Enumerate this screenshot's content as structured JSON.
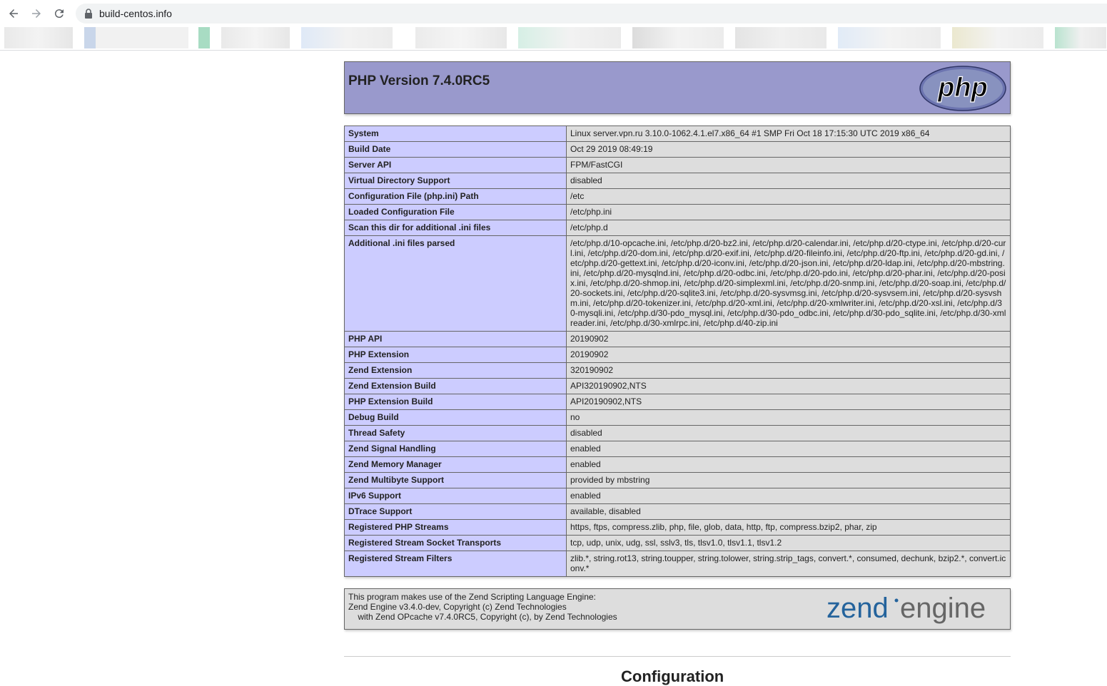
{
  "browser": {
    "url": "build-centos.info"
  },
  "header": {
    "title": "PHP Version 7.4.0RC5",
    "logo_text": "php"
  },
  "info_rows": [
    {
      "key": "System",
      "value": "Linux server.vpn.ru 3.10.0-1062.4.1.el7.x86_64 #1 SMP Fri Oct 18 17:15:30 UTC 2019 x86_64"
    },
    {
      "key": "Build Date",
      "value": "Oct 29 2019 08:49:19"
    },
    {
      "key": "Server API",
      "value": "FPM/FastCGI"
    },
    {
      "key": "Virtual Directory Support",
      "value": "disabled"
    },
    {
      "key": "Configuration File (php.ini) Path",
      "value": "/etc"
    },
    {
      "key": "Loaded Configuration File",
      "value": "/etc/php.ini"
    },
    {
      "key": "Scan this dir for additional .ini files",
      "value": "/etc/php.d"
    },
    {
      "key": "Additional .ini files parsed",
      "value": "/etc/php.d/10-opcache.ini, /etc/php.d/20-bz2.ini, /etc/php.d/20-calendar.ini, /etc/php.d/20-ctype.ini, /etc/php.d/20-curl.ini, /etc/php.d/20-dom.ini, /etc/php.d/20-exif.ini, /etc/php.d/20-fileinfo.ini, /etc/php.d/20-ftp.ini, /etc/php.d/20-gd.ini, /etc/php.d/20-gettext.ini, /etc/php.d/20-iconv.ini, /etc/php.d/20-json.ini, /etc/php.d/20-ldap.ini, /etc/php.d/20-mbstring.ini, /etc/php.d/20-mysqlnd.ini, /etc/php.d/20-odbc.ini, /etc/php.d/20-pdo.ini, /etc/php.d/20-phar.ini, /etc/php.d/20-posix.ini, /etc/php.d/20-shmop.ini, /etc/php.d/20-simplexml.ini, /etc/php.d/20-snmp.ini, /etc/php.d/20-soap.ini, /etc/php.d/20-sockets.ini, /etc/php.d/20-sqlite3.ini, /etc/php.d/20-sysvmsg.ini, /etc/php.d/20-sysvsem.ini, /etc/php.d/20-sysvshm.ini, /etc/php.d/20-tokenizer.ini, /etc/php.d/20-xml.ini, /etc/php.d/20-xmlwriter.ini, /etc/php.d/20-xsl.ini, /etc/php.d/30-mysqli.ini, /etc/php.d/30-pdo_mysql.ini, /etc/php.d/30-pdo_odbc.ini, /etc/php.d/30-pdo_sqlite.ini, /etc/php.d/30-xmlreader.ini, /etc/php.d/30-xmlrpc.ini, /etc/php.d/40-zip.ini"
    },
    {
      "key": "PHP API",
      "value": "20190902"
    },
    {
      "key": "PHP Extension",
      "value": "20190902"
    },
    {
      "key": "Zend Extension",
      "value": "320190902"
    },
    {
      "key": "Zend Extension Build",
      "value": "API320190902,NTS"
    },
    {
      "key": "PHP Extension Build",
      "value": "API20190902,NTS"
    },
    {
      "key": "Debug Build",
      "value": "no"
    },
    {
      "key": "Thread Safety",
      "value": "disabled"
    },
    {
      "key": "Zend Signal Handling",
      "value": "enabled"
    },
    {
      "key": "Zend Memory Manager",
      "value": "enabled"
    },
    {
      "key": "Zend Multibyte Support",
      "value": "provided by mbstring"
    },
    {
      "key": "IPv6 Support",
      "value": "enabled"
    },
    {
      "key": "DTrace Support",
      "value": "available, disabled"
    },
    {
      "key": "Registered PHP Streams",
      "value": "https, ftps, compress.zlib, php, file, glob, data, http, ftp, compress.bzip2, phar, zip"
    },
    {
      "key": "Registered Stream Socket Transports",
      "value": "tcp, udp, unix, udg, ssl, sslv3, tls, tlsv1.0, tlsv1.1, tlsv1.2"
    },
    {
      "key": "Registered Stream Filters",
      "value": "zlib.*, string.rot13, string.toupper, string.tolower, string.strip_tags, convert.*, consumed, dechunk, bzip2.*, convert.iconv.*"
    }
  ],
  "zend": {
    "line1": "This program makes use of the Zend Scripting Language Engine:",
    "line2": "Zend Engine v3.4.0-dev, Copyright (c) Zend Technologies",
    "line3": "    with Zend OPcache v7.4.0RC5, Copyright (c), by Zend Technologies",
    "logo_word1": "zend",
    "logo_word2": "engine"
  },
  "next_section": {
    "title": "Configuration"
  },
  "colors": {
    "header_bg": "#9999cc",
    "key_bg": "#ccccff",
    "value_bg": "#dddddd"
  }
}
